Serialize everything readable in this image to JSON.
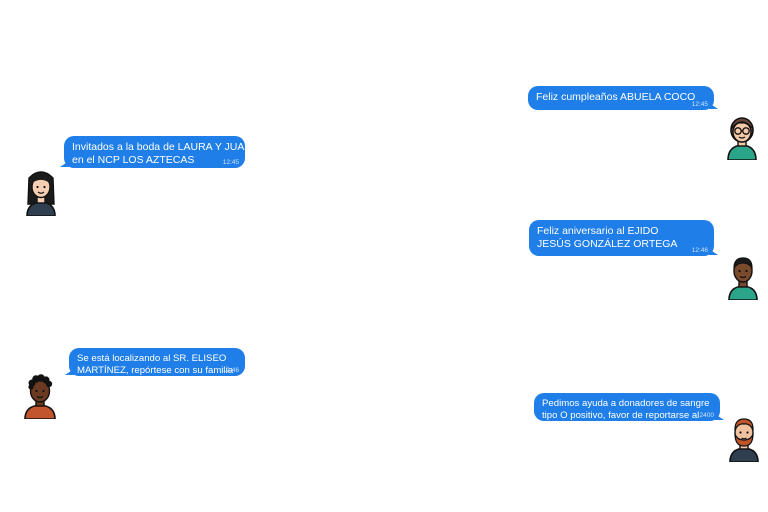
{
  "messages": [
    {
      "lines": [
        "Feliz cumpleaños ABUELA COCO"
      ],
      "time": "12:45",
      "side": "right",
      "avatar": "woman-with-glasses-icon"
    },
    {
      "lines": [
        "Invitados a la boda de LAURA Y JUA,",
        "en el NCP LOS AZTECAS"
      ],
      "time": "12:45",
      "side": "left",
      "avatar": "woman-long-hair-icon"
    },
    {
      "lines": [
        "Feliz aniversario al EJIDO",
        "JESÚS GONZÁLEZ ORTEGA"
      ],
      "time": "12:46",
      "side": "right",
      "avatar": "man-short-hair-icon"
    },
    {
      "lines": [
        "Se está localizando al SR. ELISEO",
        "MARTÍNEZ, repórtese con su familia"
      ],
      "time": "12:46",
      "side": "left",
      "avatar": "man-curly-hair-icon"
    },
    {
      "lines": [
        "Pedimos ayuda a donadores de sangre",
        "tipo O positivo, favor de reportarse al"
      ],
      "time": "2400",
      "side": "right",
      "avatar": "man-beard-icon"
    }
  ],
  "colors": {
    "bubble": "#1f7ee8",
    "bubble_text": "#ffffff"
  }
}
